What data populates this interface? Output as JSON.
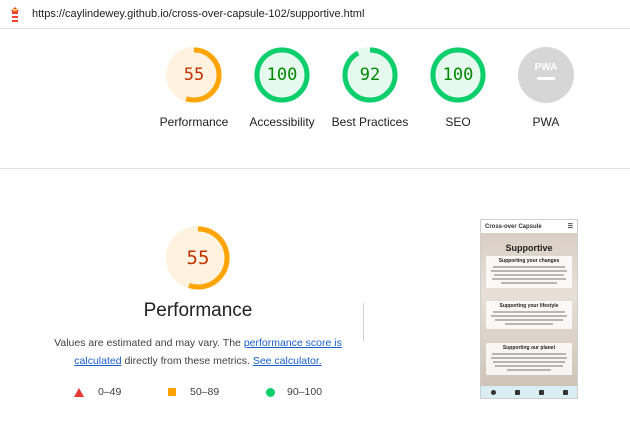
{
  "url": "https://caylindewey.github.io/cross-over-capsule-102/supportive.html",
  "colors": {
    "fail": "#e53935",
    "average": "#ffa400",
    "pass": "#0cce6b",
    "pwa": "#cccccc"
  },
  "gauges": [
    {
      "label": "Performance",
      "score": 55,
      "status": "average"
    },
    {
      "label": "Accessibility",
      "score": 100,
      "status": "pass"
    },
    {
      "label": "Best Practices",
      "score": 92,
      "status": "pass"
    },
    {
      "label": "SEO",
      "score": 100,
      "status": "pass"
    },
    {
      "label": "PWA",
      "score": null,
      "status": "na"
    }
  ],
  "main": {
    "score": "55",
    "title": "Performance",
    "desc_pre": "Values are estimated and may vary. The ",
    "link1": "performance score is calculated",
    "desc_mid": " directly from these metrics. ",
    "link2": "See calculator."
  },
  "legend": [
    {
      "range": "0–49",
      "icon": "triangle-icon"
    },
    {
      "range": "50–89",
      "icon": "square-icon"
    },
    {
      "range": "90–100",
      "icon": "circle-icon"
    }
  ],
  "preview": {
    "site_name": "Cross-over Capsule",
    "heading": "Supportive",
    "cards": [
      "Supporting your changes",
      "Supporting your lifestyle",
      "Supporting our planet"
    ]
  }
}
